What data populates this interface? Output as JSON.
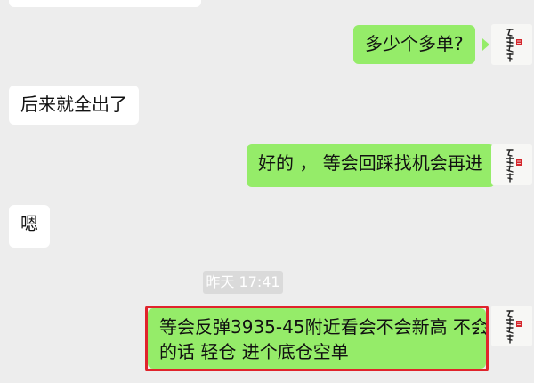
{
  "messages": [
    {
      "side": "right",
      "text": "多少个多单?"
    },
    {
      "side": "left",
      "text": "后来就全出了"
    },
    {
      "side": "right",
      "text": "好的 ， 等会回踩找机会再进"
    },
    {
      "side": "left",
      "text": "嗯"
    },
    {
      "side": "right",
      "lines": [
        "等会反弹3935-45附近看会不会新高 不会",
        "的话 轻仓 进个底仓空单"
      ]
    }
  ],
  "timestamp": "昨天 17:41",
  "colors": {
    "background": "#ededed",
    "incoming_bubble": "#ffffff",
    "outgoing_bubble": "#95ec69",
    "highlight_border": "#e0242c",
    "avatar_seal": "#d4262c"
  },
  "avatar_icon": "calligraphy-seal-icon"
}
